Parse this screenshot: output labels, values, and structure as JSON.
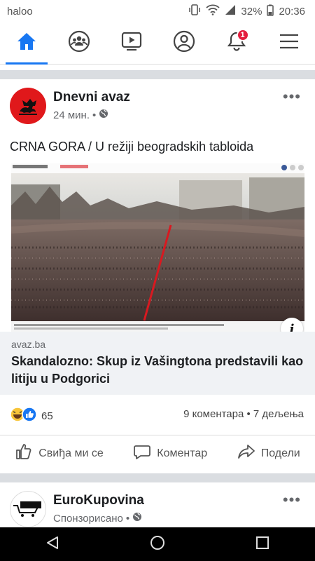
{
  "statusbar": {
    "carrier": "haloo",
    "battery": "32%",
    "time": "20:36"
  },
  "nav": {
    "notifications_badge": "1"
  },
  "post": {
    "author": "Dnevni avaz",
    "time": "24 мин.",
    "text": "CRNA GORA / U režiji beogradskih tabloida",
    "link": {
      "domain": "avaz.ba",
      "title": "Skandalozno: Skup iz Vašingtona predstavili kao litiju u Podgorici"
    },
    "reactions_count": "65",
    "comments_shares": "9 коментара • 7 дељења",
    "actions": {
      "like": "Свиђа ми се",
      "comment": "Коментар",
      "share": "Подели"
    }
  },
  "post2": {
    "author": "EuroKupovina",
    "meta": "Спонзорисано"
  },
  "colors": {
    "accent": "#1877f2",
    "badge": "#e41e3f"
  }
}
